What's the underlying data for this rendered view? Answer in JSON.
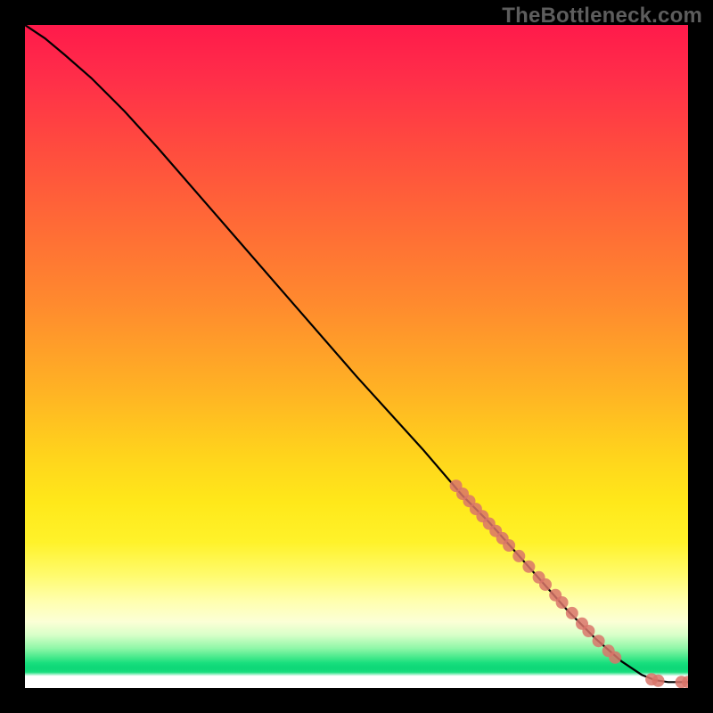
{
  "watermark": "TheBottleneck.com",
  "colors": {
    "background": "#000000",
    "watermark": "#5d5d5d",
    "curve": "#000000",
    "marker": "#d9746a",
    "gradient_top": "#ff1a4b",
    "gradient_mid": "#ffe81a",
    "gradient_green": "#19df7e"
  },
  "chart_data": {
    "type": "line",
    "title": "",
    "xlabel": "",
    "ylabel": "",
    "xlim": [
      0,
      100
    ],
    "ylim": [
      0,
      100
    ],
    "series": [
      {
        "name": "curve",
        "x": [
          0,
          3,
          6,
          10,
          15,
          20,
          30,
          40,
          50,
          60,
          66,
          70,
          74,
          78,
          82,
          86,
          90,
          93,
          95,
          97,
          98.5,
          100
        ],
        "y": [
          100,
          98,
          95.5,
          92,
          87,
          81.5,
          70,
          58.5,
          47,
          36,
          29,
          25,
          20.5,
          16,
          11.5,
          7.5,
          4,
          2,
          1.2,
          0.9,
          0.9,
          0.9
        ]
      }
    ],
    "markers": {
      "name": "highlighted-points",
      "x": [
        65,
        66,
        67,
        68,
        69,
        70,
        71,
        72,
        73,
        74.5,
        76,
        77.5,
        78.5,
        80,
        81,
        82.5,
        84,
        85,
        86.5,
        88,
        89,
        94.5,
        95.5,
        99,
        100
      ],
      "y": [
        30.5,
        29.3,
        28.2,
        27,
        25.9,
        24.8,
        23.7,
        22.6,
        21.5,
        19.9,
        18.3,
        16.7,
        15.6,
        14,
        12.9,
        11.3,
        9.7,
        8.6,
        7.1,
        5.6,
        4.6,
        1.3,
        1.1,
        0.9,
        0.9
      ]
    }
  }
}
